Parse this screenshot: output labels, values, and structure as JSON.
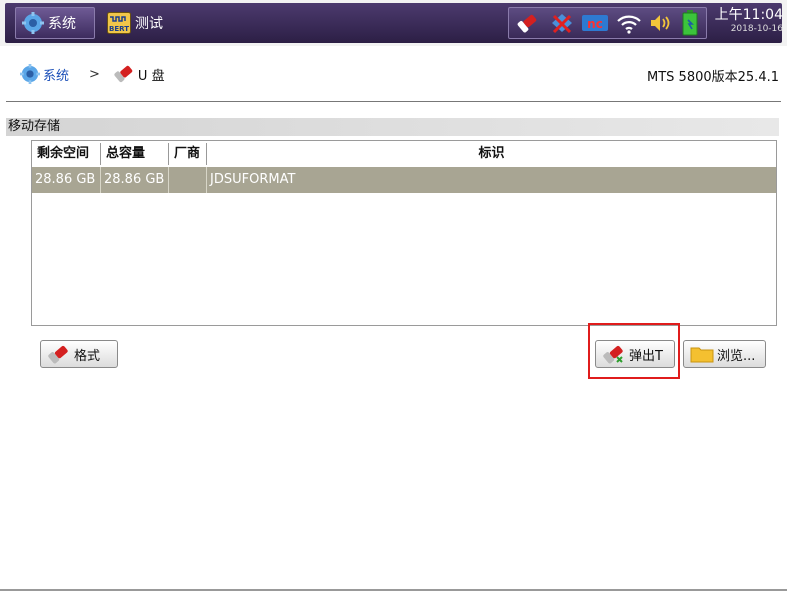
{
  "topbar": {
    "system_tab": "系统",
    "test_tab": "测试",
    "bert_badge": "BERT",
    "status_icons": [
      "usb-icon",
      "network-disconnected-icon",
      "nc-icon",
      "wifi-icon",
      "speaker-icon",
      "battery-icon"
    ],
    "time": "上午11:04",
    "date": "2018-10-16"
  },
  "breadcrumb": {
    "root": "系统",
    "separator": ">",
    "current": "U 盘"
  },
  "version": "MTS 5800版本25.4.1",
  "section": {
    "title": "移动存储"
  },
  "table": {
    "headers": [
      "剩余空间",
      "总容量",
      "厂商",
      "标识"
    ],
    "rows": [
      {
        "free": "28.86 GB",
        "total": "28.86 GB",
        "vendor": "",
        "label": "JDSUFORMAT"
      }
    ]
  },
  "buttons": {
    "format": "格式",
    "eject": "弹出T",
    "browse": "浏览..."
  },
  "colors": {
    "topbar": "#3a2a58",
    "selected_row": "#a8a593",
    "highlight": "#e01c1c",
    "link": "#1b4fb8"
  }
}
